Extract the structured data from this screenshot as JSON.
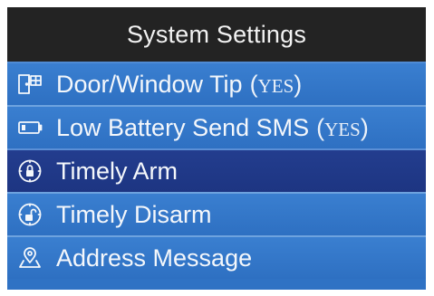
{
  "header": {
    "title": "System Settings"
  },
  "menu": {
    "items": [
      {
        "label": "Door/Window Tip",
        "status": "YES",
        "icon": "door-window-icon",
        "selected": false
      },
      {
        "label": "Low Battery Send SMS",
        "status": "YES",
        "icon": "battery-icon",
        "selected": false
      },
      {
        "label": "Timely Arm",
        "status": "",
        "icon": "timer-lock-icon",
        "selected": true
      },
      {
        "label": "Timely Disarm",
        "status": "",
        "icon": "timer-unlock-icon",
        "selected": false
      },
      {
        "label": "Address Message",
        "status": "",
        "icon": "location-icon",
        "selected": false
      }
    ]
  },
  "colors": {
    "header_bg": "#232323",
    "item_bg": "#2f72c4",
    "selected_bg": "#1f3887",
    "text": "#f4f7fb"
  }
}
